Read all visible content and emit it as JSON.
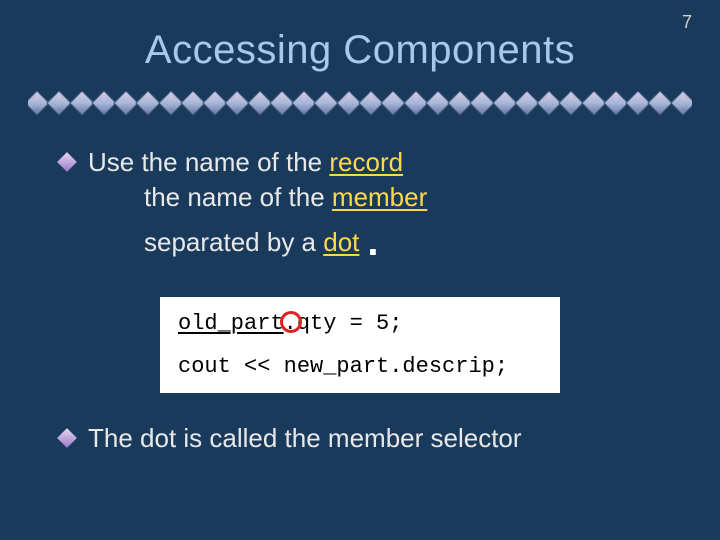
{
  "slideNumber": "7",
  "title": "Accessing Components",
  "bullet1": {
    "prefix": "Use the name of the ",
    "kw1": "record",
    "line2a": "the name of the ",
    "kw2": "member",
    "line3a": "separated by a ",
    "kw3": "dot",
    "dot": "."
  },
  "code": {
    "line1_a": "old_part",
    "line1_b": ".qty = 5;",
    "line2": "cout << new_part.descrip;"
  },
  "bullet2": "The dot is called the member selector"
}
